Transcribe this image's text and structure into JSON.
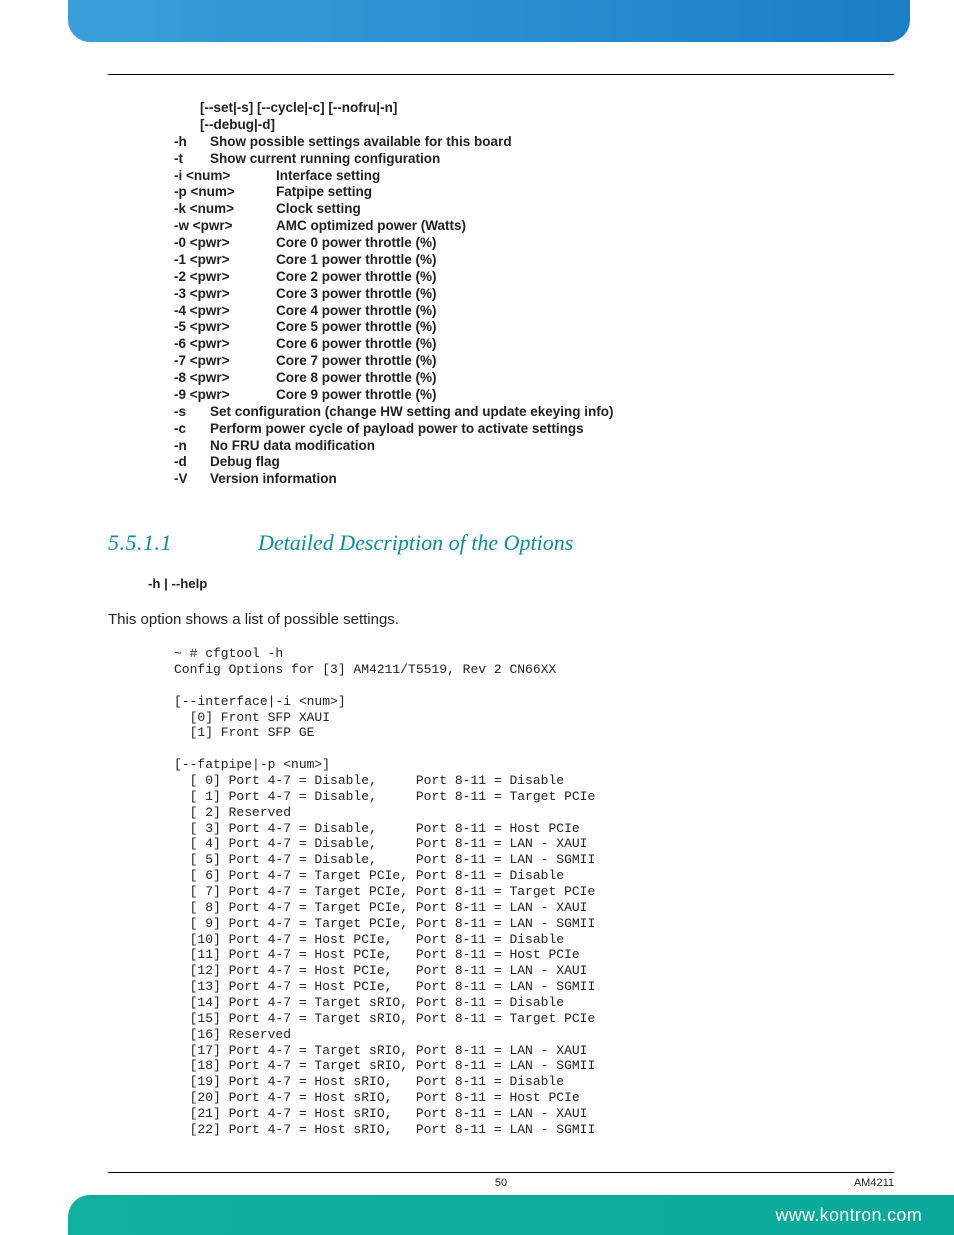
{
  "top_options": {
    "group_lines": [
      "[--set|-s] [--cycle|-c] [--nofru|-n]",
      "[--debug|-d]"
    ],
    "rows": [
      {
        "flag": "-h",
        "desc": "Show possible settings available for this board",
        "tight": true
      },
      {
        "flag": "-t",
        "desc": "Show current running configuration",
        "tight": true
      },
      {
        "flag": "-i <num>",
        "desc": "Interface setting"
      },
      {
        "flag": "-p <num>",
        "desc": "Fatpipe setting"
      },
      {
        "flag": "-k <num>",
        "desc": "Clock setting"
      },
      {
        "flag": "-w <pwr>",
        "desc": "AMC optimized power (Watts)"
      },
      {
        "flag": "-0 <pwr>",
        "desc": "Core 0 power throttle (%)"
      },
      {
        "flag": "-1 <pwr>",
        "desc": "Core 1 power throttle (%)"
      },
      {
        "flag": "-2 <pwr>",
        "desc": "Core 2 power throttle (%)"
      },
      {
        "flag": "-3 <pwr>",
        "desc": "Core 3 power throttle (%)"
      },
      {
        "flag": "-4 <pwr>",
        "desc": "Core 4 power throttle (%)"
      },
      {
        "flag": "-5 <pwr>",
        "desc": "Core 5 power throttle (%)"
      },
      {
        "flag": "-6 <pwr>",
        "desc": "Core 6 power throttle (%)"
      },
      {
        "flag": "-7 <pwr>",
        "desc": "Core 7 power throttle (%)"
      },
      {
        "flag": "-8 <pwr>",
        "desc": "Core 8 power throttle (%)"
      },
      {
        "flag": "-9 <pwr>",
        "desc": "Core 9 power throttle (%)"
      },
      {
        "flag": "-s",
        "desc": "Set configuration (change HW setting and update ekeying info)",
        "tight": true
      },
      {
        "flag": "-c",
        "desc": "Perform power cycle of payload power to activate settings",
        "tight": true
      },
      {
        "flag": "-n",
        "desc": "No FRU data modification",
        "tight": true
      },
      {
        "flag": "-d",
        "desc": "Debug flag",
        "tight": true
      },
      {
        "flag": "-V",
        "desc": "Version information",
        "tight": true
      }
    ]
  },
  "section": {
    "number": "5.5.1.1",
    "title": "Detailed Description of the Options"
  },
  "help_flag": "-h | --help",
  "help_desc": "This option shows a list of possible settings.",
  "code_block": "~ # cfgtool -h\nConfig Options for [3] AM4211/T5519, Rev 2 CN66XX\n\n[--interface|-i <num>]\n  [0] Front SFP XAUI\n  [1] Front SFP GE\n\n[--fatpipe|-p <num>]\n  [ 0] Port 4-7 = Disable,     Port 8-11 = Disable\n  [ 1] Port 4-7 = Disable,     Port 8-11 = Target PCIe\n  [ 2] Reserved\n  [ 3] Port 4-7 = Disable,     Port 8-11 = Host PCIe\n  [ 4] Port 4-7 = Disable,     Port 8-11 = LAN - XAUI\n  [ 5] Port 4-7 = Disable,     Port 8-11 = LAN - SGMII\n  [ 6] Port 4-7 = Target PCIe, Port 8-11 = Disable\n  [ 7] Port 4-7 = Target PCIe, Port 8-11 = Target PCIe\n  [ 8] Port 4-7 = Target PCIe, Port 8-11 = LAN - XAUI\n  [ 9] Port 4-7 = Target PCIe, Port 8-11 = LAN - SGMII\n  [10] Port 4-7 = Host PCIe,   Port 8-11 = Disable\n  [11] Port 4-7 = Host PCIe,   Port 8-11 = Host PCIe\n  [12] Port 4-7 = Host PCIe,   Port 8-11 = LAN - XAUI\n  [13] Port 4-7 = Host PCIe,   Port 8-11 = LAN - SGMII\n  [14] Port 4-7 = Target sRIO, Port 8-11 = Disable\n  [15] Port 4-7 = Target sRIO, Port 8-11 = Target PCIe\n  [16] Reserved\n  [17] Port 4-7 = Target sRIO, Port 8-11 = LAN - XAUI\n  [18] Port 4-7 = Target sRIO, Port 8-11 = LAN - SGMII\n  [19] Port 4-7 = Host sRIO,   Port 8-11 = Disable\n  [20] Port 4-7 = Host sRIO,   Port 8-11 = Host PCIe\n  [21] Port 4-7 = Host sRIO,   Port 8-11 = LAN - XAUI\n  [22] Port 4-7 = Host sRIO,   Port 8-11 = LAN - SGMII",
  "footer": {
    "page": "50",
    "product": "AM4211",
    "url": "www.kontron.com"
  }
}
